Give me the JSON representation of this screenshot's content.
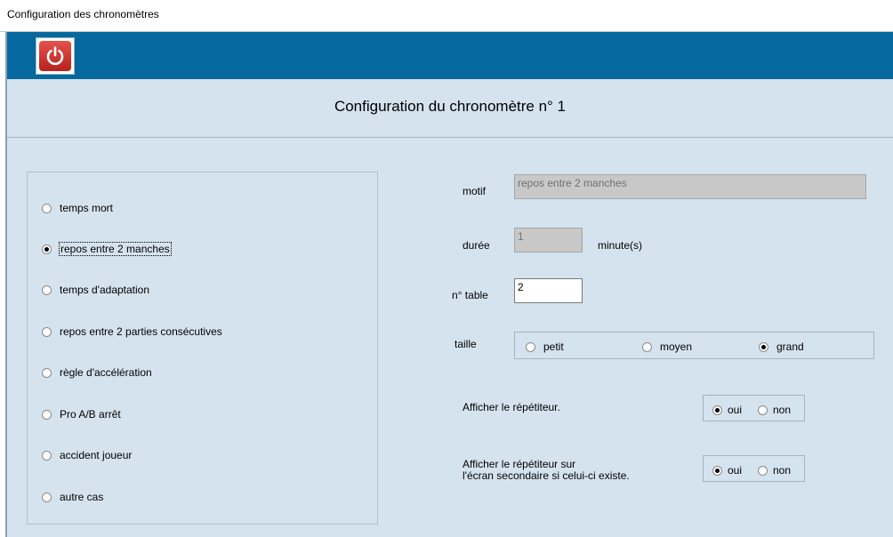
{
  "window": {
    "title": "Configuration des chronomètres"
  },
  "toolbar": {
    "power_icon": "power-icon",
    "accent_color": "#05689e"
  },
  "header": {
    "title": "Configuration du chronomètre n° 1"
  },
  "reasons": [
    {
      "label": "temps mort",
      "selected": false
    },
    {
      "label": "repos entre 2 manches",
      "selected": true
    },
    {
      "label": "temps d'adaptation",
      "selected": false
    },
    {
      "label": "repos entre 2 parties consécutives",
      "selected": false
    },
    {
      "label": "règle d'accélération",
      "selected": false
    },
    {
      "label": "Pro A/B arrêt",
      "selected": false
    },
    {
      "label": "accident joueur",
      "selected": false
    },
    {
      "label": "autre cas",
      "selected": false
    }
  ],
  "form": {
    "motif_label": "motif",
    "motif_value": "repos entre 2 manches",
    "duree_label": "durée",
    "duree_value": "1",
    "duree_unit": "minute(s)",
    "table_label": "n° table",
    "table_value": "2",
    "taille_label": "taille",
    "taille_options": {
      "petit": "petit",
      "moyen": "moyen",
      "grand": "grand"
    },
    "taille_selected": "grand",
    "repeater_label": "Afficher le répétiteur.",
    "repeater_selected": "oui",
    "secondary_label_line1": "Afficher le répétiteur sur",
    "secondary_label_line2": "l'écran secondaire si celui-ci existe.",
    "secondary_selected": "oui",
    "yes_label": "oui",
    "no_label": "non"
  }
}
